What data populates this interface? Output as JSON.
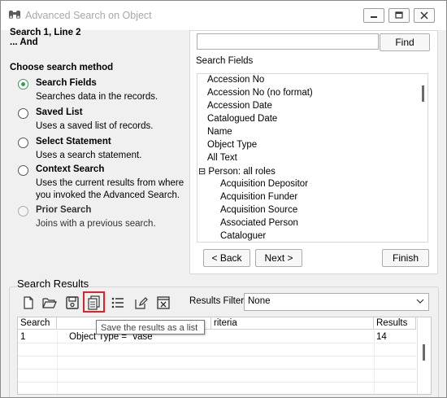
{
  "window": {
    "title": "Advanced Search on Object",
    "minimize_label": "",
    "maximize_label": "",
    "close_label": ""
  },
  "context": {
    "line1": "Search 1, Line 2",
    "line2": "... And"
  },
  "method": {
    "heading": "Choose search method",
    "options": [
      {
        "label": "Search Fields",
        "desc": "Searches data in the records.",
        "selected": true,
        "enabled": true
      },
      {
        "label": "Saved List",
        "desc": "Uses a saved list of records.",
        "selected": false,
        "enabled": true
      },
      {
        "label": "Select Statement",
        "desc": "Uses a search statement.",
        "selected": false,
        "enabled": true
      },
      {
        "label": "Context Search",
        "desc": "Uses the current results from where you invoked the Advanced Search.",
        "selected": false,
        "enabled": true
      },
      {
        "label": "Prior Search",
        "desc": "Joins with a previous search.",
        "selected": false,
        "enabled": false
      }
    ]
  },
  "search": {
    "value": "",
    "placeholder": "",
    "find_label": "Find"
  },
  "fields": {
    "label": "Search Fields",
    "items": [
      {
        "text": "Accession No",
        "level": 0
      },
      {
        "text": "Accession No (no format)",
        "level": 0
      },
      {
        "text": "Accession Date",
        "level": 0
      },
      {
        "text": "Catalogued Date",
        "level": 0
      },
      {
        "text": "Name",
        "level": 0
      },
      {
        "text": "Object Type",
        "level": 0
      },
      {
        "text": "All Text",
        "level": 0
      },
      {
        "text": "Person: all roles",
        "level": 0,
        "expander": "⊟"
      },
      {
        "text": "Acquisition Depositor",
        "level": 1
      },
      {
        "text": "Acquisition Funder",
        "level": 1
      },
      {
        "text": "Acquisition Source",
        "level": 1
      },
      {
        "text": "Associated Person",
        "level": 1
      },
      {
        "text": "Cataloguer",
        "level": 1
      }
    ]
  },
  "nav": {
    "back_label": "< Back",
    "next_label": "Next >",
    "finish_label": "Finish"
  },
  "results": {
    "group_title": "Search Results",
    "toolbar_icons": [
      "new-icon",
      "open-folder-icon",
      "save-icon",
      "save-as-list-icon",
      "list-icon",
      "edit-icon",
      "clear-icon"
    ],
    "filter_label": "Results Filter",
    "filter_value": "None",
    "columns": [
      "Search",
      "",
      "riteria",
      "Results"
    ],
    "rows": [
      {
        "search": "1",
        "criteria": "Object Type = \"vase\"",
        "results": "14"
      }
    ],
    "tooltip": "Save the results as a list"
  },
  "colors": {
    "highlight": "#e0202a",
    "radio_selected": "#3a9a5a"
  }
}
